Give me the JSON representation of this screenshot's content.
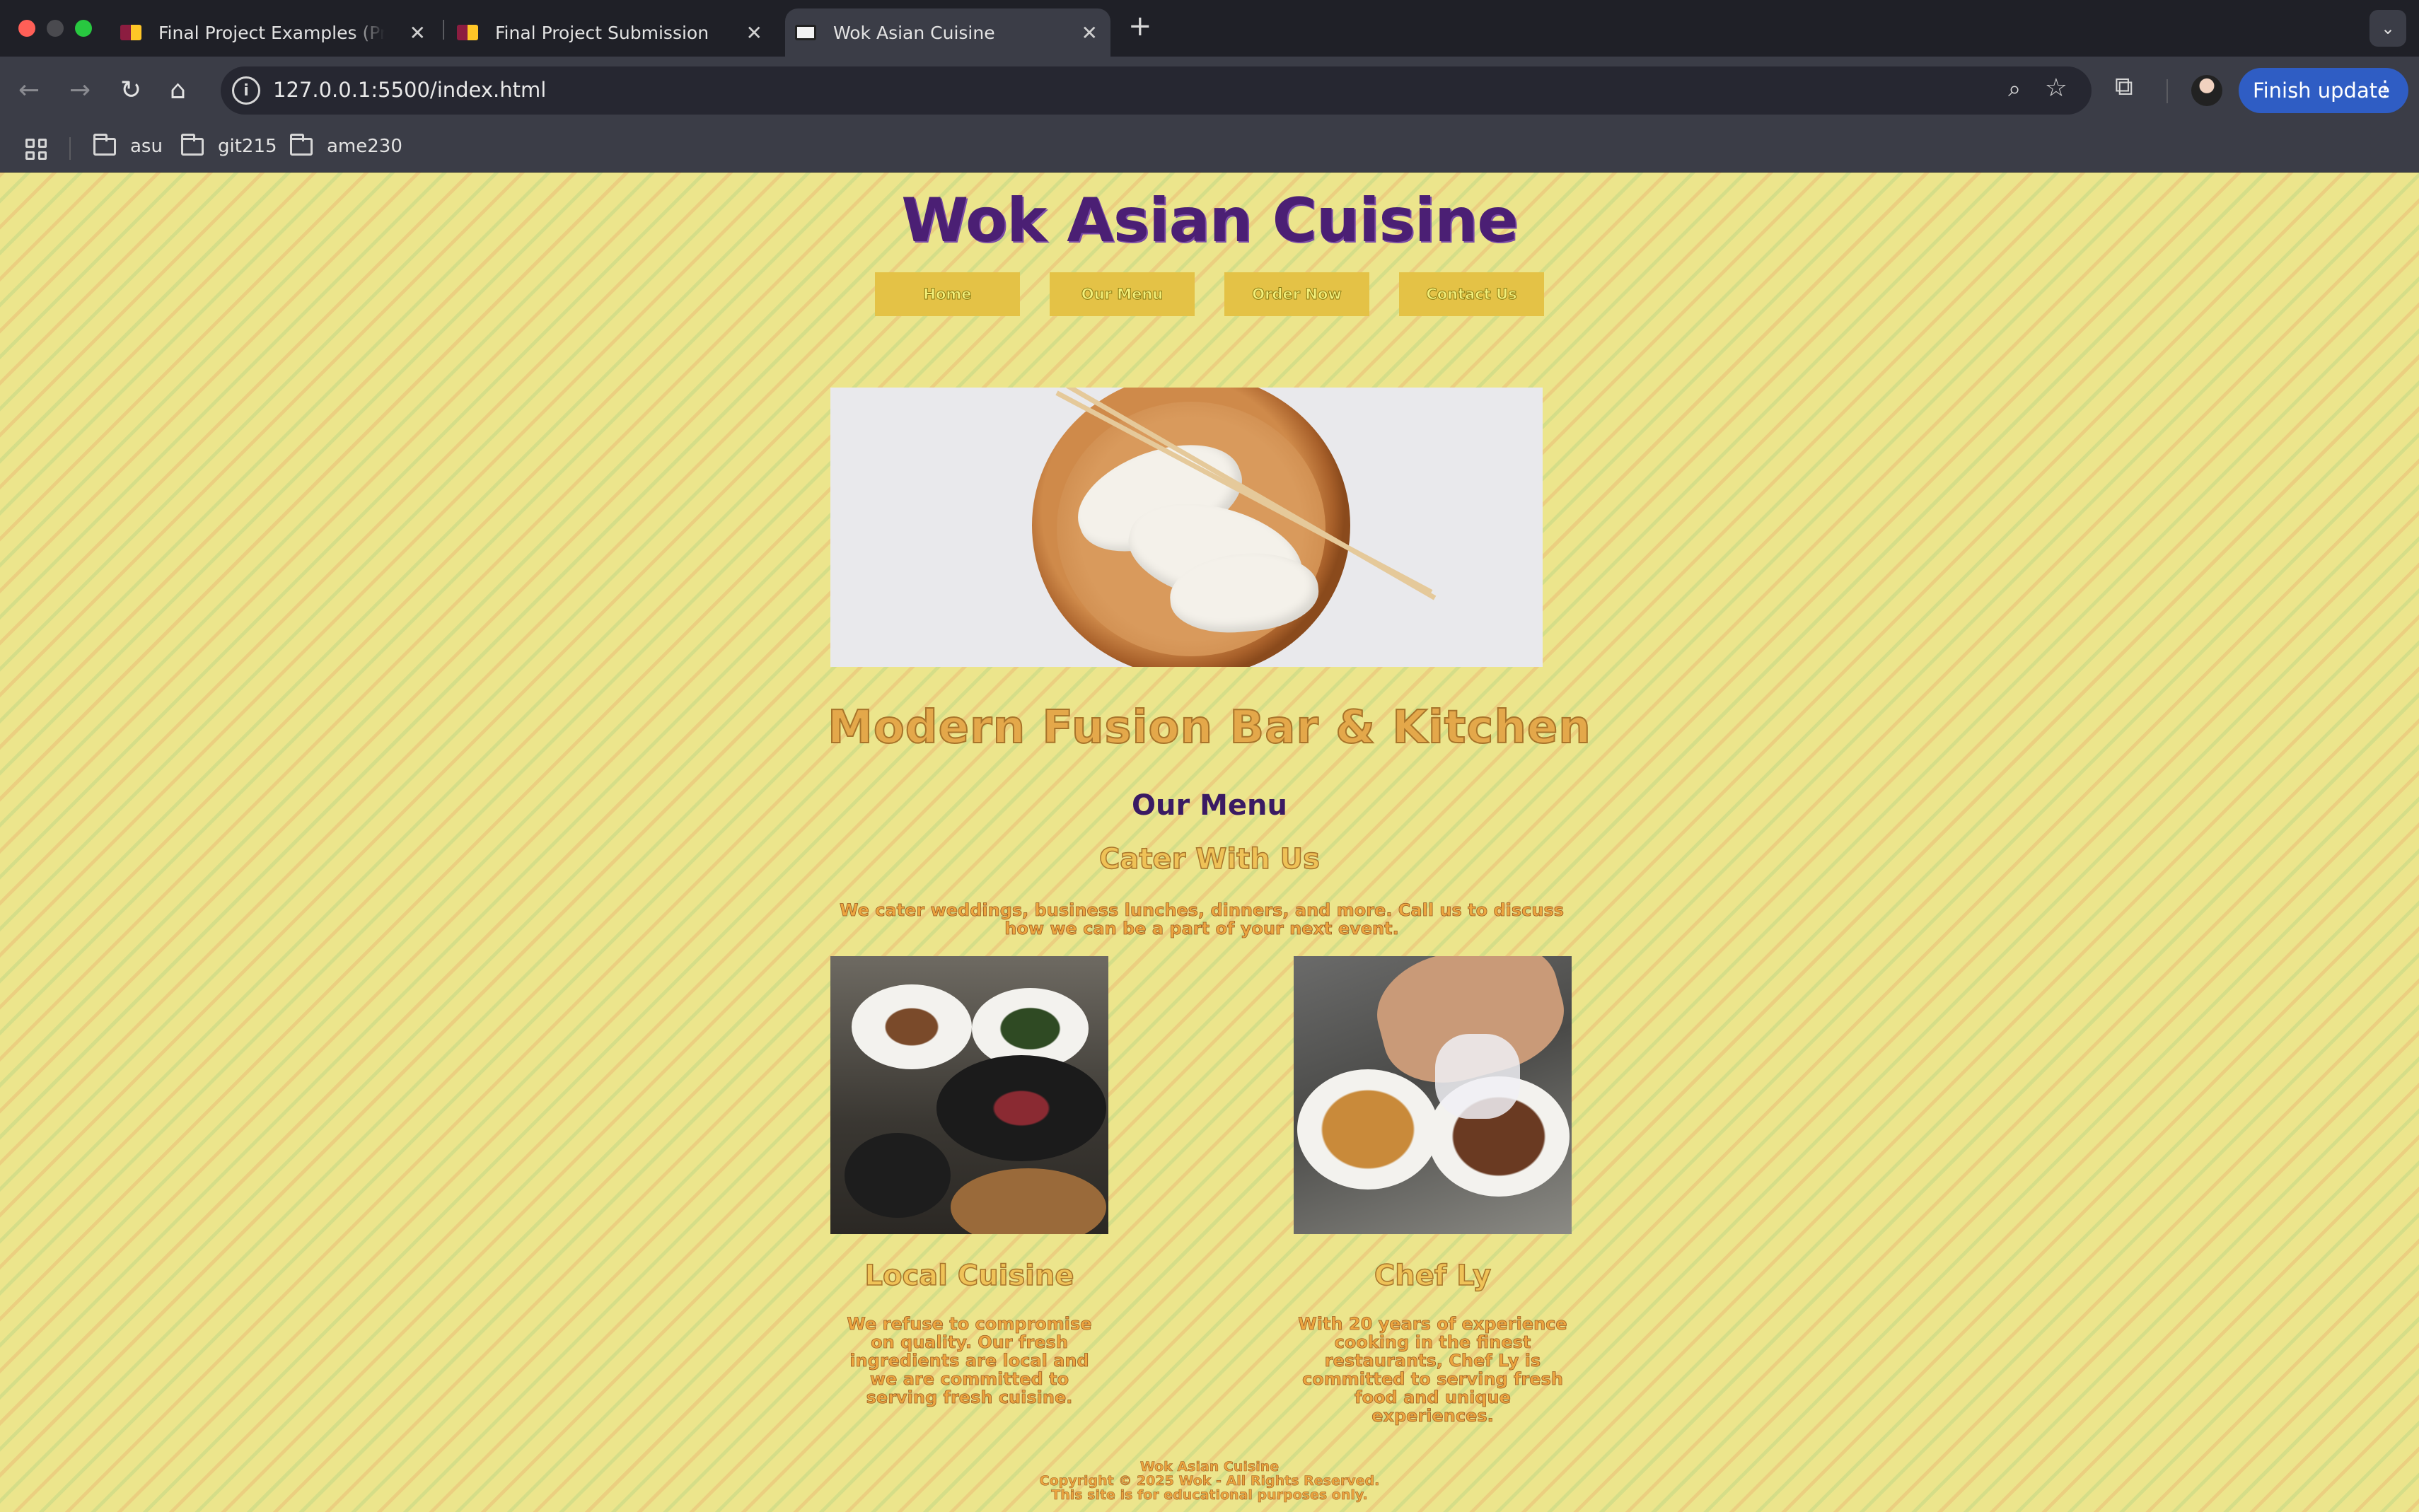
{
  "browser": {
    "tabs": [
      {
        "title": "Final Project Examples (Previous)",
        "active": false
      },
      {
        "title": "Final Project Submission",
        "active": false
      },
      {
        "title": "Wok Asian Cuisine",
        "active": true
      }
    ],
    "url": "127.0.0.1:5500/index.html",
    "update_button": "Finish update",
    "bookmarks": [
      "asu",
      "git215",
      "ame230"
    ],
    "accent_color": "#2f5dc4"
  },
  "site": {
    "title": "Wok Asian Cuisine",
    "nav": [
      "Home",
      "Our Menu",
      "Order Now",
      "Contact Us"
    ],
    "subtitle": "Modern Fusion Bar & Kitchen",
    "menu_heading": "Our Menu",
    "cater_heading": "Cater With Us",
    "cater_text": "We cater weddings, business lunches, dinners, and more. Call us to discuss how we can be a part of your next event.",
    "cards": [
      {
        "title": "Local Cuisine",
        "text": "We refuse to compromise on quality. Our fresh ingredients are local and we are committed to serving fresh cuisine."
      },
      {
        "title": "Chef Ly",
        "text": "With 20 years of experience cooking in the finest restaurants, Chef Ly is committed to serving fresh food and unique experiences."
      }
    ],
    "footer": {
      "line1": "Wok Asian Cuisine",
      "line2": "Copyright © 2025 Wok - All Rights Reserved.",
      "line3": "This site is for educational purposes only."
    },
    "colors": {
      "background": "#ece58c",
      "title": "#4b1f74",
      "nav_button": "#e4c246",
      "accent_text": "#eda640"
    }
  }
}
